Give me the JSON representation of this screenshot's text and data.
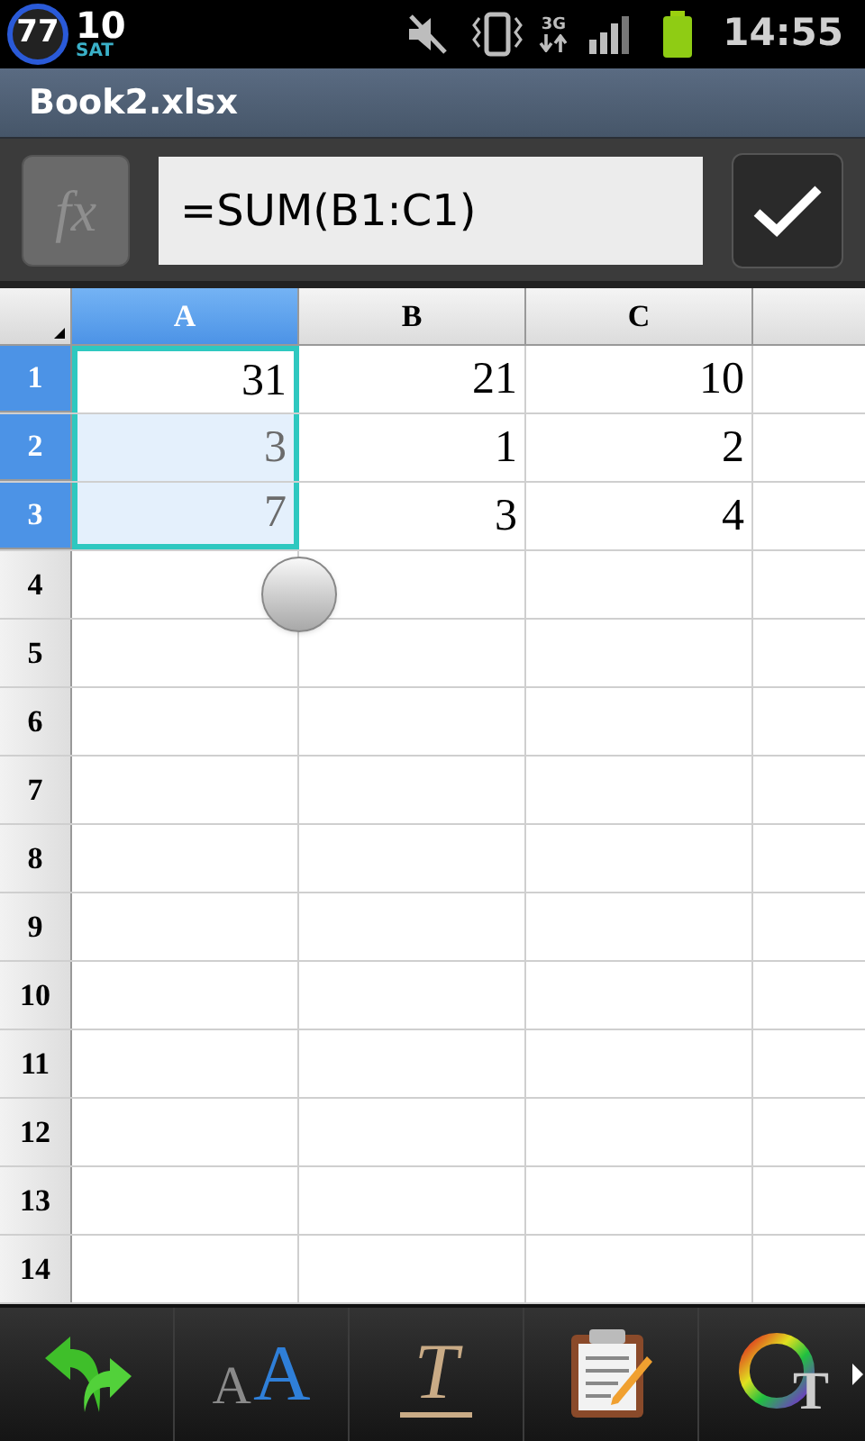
{
  "status_bar": {
    "battery_badge": "77",
    "date": "10",
    "weekday": "SAT",
    "network": "3G",
    "time": "14:55"
  },
  "window": {
    "title": "Book2.xlsx"
  },
  "formula_bar": {
    "function_button": {
      "label": "fx",
      "disabled": true
    },
    "value": "=SUM(B1:C1)"
  },
  "sheet": {
    "columns": [
      {
        "label": "A",
        "selected": true
      },
      {
        "label": "B",
        "selected": false
      },
      {
        "label": "C",
        "selected": false
      }
    ],
    "rows": [
      {
        "header": "1",
        "selected": true,
        "cells": [
          {
            "value": "31",
            "selected": true
          },
          {
            "value": "21",
            "selected": false
          },
          {
            "value": "10",
            "selected": false
          }
        ]
      },
      {
        "header": "2",
        "selected": true,
        "cells": [
          {
            "value": "3",
            "selected": true
          },
          {
            "value": "1",
            "selected": false
          },
          {
            "value": "2",
            "selected": false
          }
        ]
      },
      {
        "header": "3",
        "selected": true,
        "cells": [
          {
            "value": "7",
            "selected": true
          },
          {
            "value": "3",
            "selected": false
          },
          {
            "value": "4",
            "selected": false
          }
        ]
      },
      {
        "header": "4",
        "selected": false
      },
      {
        "header": "5",
        "selected": false
      },
      {
        "header": "6",
        "selected": false
      },
      {
        "header": "7",
        "selected": false
      },
      {
        "header": "8",
        "selected": false
      },
      {
        "header": "9",
        "selected": false
      },
      {
        "header": "10",
        "selected": false
      },
      {
        "header": "11",
        "selected": false
      },
      {
        "header": "12",
        "selected": false
      },
      {
        "header": "13",
        "selected": false
      },
      {
        "header": "14",
        "selected": false
      }
    ]
  },
  "toolbar": [
    {
      "kind": "swap"
    },
    {
      "kind": "font_size",
      "glyph_small": "A",
      "glyph_large": "A"
    },
    {
      "kind": "text_style",
      "glyph": "T"
    },
    {
      "kind": "clipboard"
    },
    {
      "kind": "color",
      "glyph": "T"
    }
  ]
}
